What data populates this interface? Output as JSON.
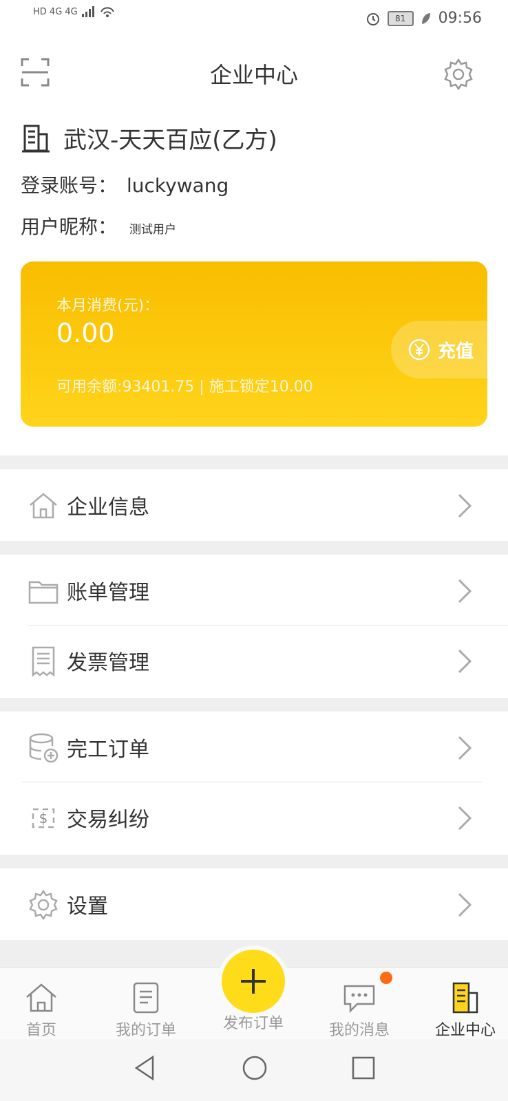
{
  "status": {
    "left_text": "HD 4G 4G",
    "battery": "81",
    "time": "09:56"
  },
  "header": {
    "title": "企业中心"
  },
  "company": {
    "name": "武汉-天天百应(乙方)",
    "login_label": "登录账号：",
    "login_value": "luckywang",
    "nick_label": "用户昵称：",
    "nick_value": "测试用户"
  },
  "card": {
    "label": "本月消费(元)：",
    "amount": "0.00",
    "sub": "可用余额:93401.75 | 施工锁定10.00",
    "recharge_label": "充值"
  },
  "menu": {
    "company_info": "企业信息",
    "bill_mgmt": "账单管理",
    "invoice_mgmt": "发票管理",
    "finished_orders": "完工订单",
    "disputes": "交易纠纷",
    "settings": "设置"
  },
  "nav": {
    "home": "首页",
    "my_orders": "我的订单",
    "publish": "发布订单",
    "messages": "我的消息",
    "company_center": "企业中心"
  },
  "colors": {
    "accent": "#ffd41a",
    "badge": "#ff6a13"
  }
}
